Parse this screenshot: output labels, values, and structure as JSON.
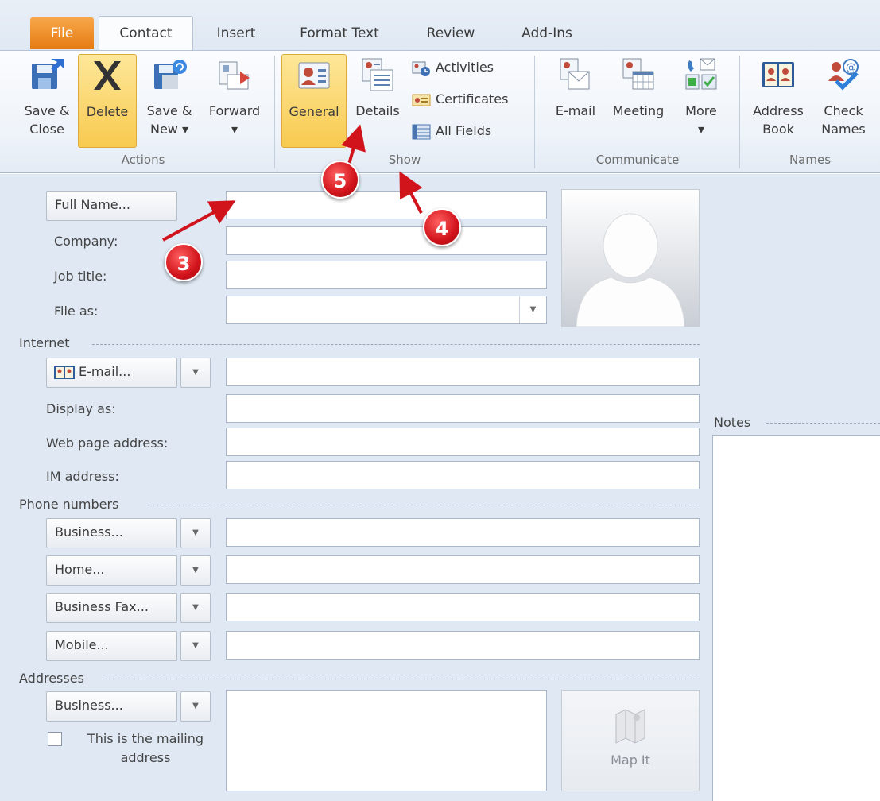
{
  "tabs": {
    "file": "File",
    "contact": "Contact",
    "insert": "Insert",
    "format_text": "Format Text",
    "review": "Review",
    "add_ins": "Add-Ins"
  },
  "ribbon": {
    "actions": {
      "label": "Actions",
      "save_close": "Save &\nClose",
      "delete": "Delete",
      "save_new": "Save &\nNew ▾",
      "forward": "Forward\n▾"
    },
    "show": {
      "label": "Show",
      "general": "General",
      "details": "Details",
      "activities": "Activities",
      "certificates": "Certificates",
      "all_fields": "All Fields"
    },
    "communicate": {
      "label": "Communicate",
      "email": "E-mail",
      "meeting": "Meeting",
      "more": "More\n▾"
    },
    "names": {
      "label": "Names",
      "address_book": "Address\nBook",
      "check_names": "Check\nNames"
    }
  },
  "form": {
    "full_name_button": "Full Name...",
    "company_label": "Company:",
    "job_title_label": "Job title:",
    "file_as_label": "File as:",
    "internet_section": "Internet",
    "email_button": "E-mail...",
    "display_as_label": "Display as:",
    "web_page_label": "Web page address:",
    "im_address_label": "IM address:",
    "phone_section": "Phone numbers",
    "phone_business": "Business...",
    "phone_home": "Home...",
    "phone_business_fax": "Business Fax...",
    "phone_mobile": "Mobile...",
    "addresses_section": "Addresses",
    "address_business": "Business...",
    "mailing_address": "This is the mailing\naddress",
    "map_it": "Map It",
    "notes_section": "Notes"
  },
  "markers": {
    "m3": "3",
    "m4": "4",
    "m5": "5"
  },
  "colors": {
    "file_tab": "#e57a12",
    "active_button": "#f8ca4f",
    "marker": "#d1131b",
    "arrow": "#d1131b"
  }
}
